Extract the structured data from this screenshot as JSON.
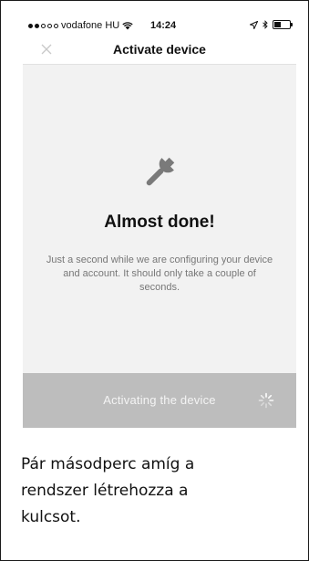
{
  "status_bar": {
    "carrier": "vodafone HU",
    "time": "14:24",
    "signal_bars_filled": 2,
    "signal_bars_total": 5,
    "battery_level": 0.45,
    "icons": [
      "signal-dots-icon",
      "wifi-icon",
      "location-arrow-icon",
      "bluetooth-icon",
      "battery-icon"
    ]
  },
  "nav": {
    "title": "Activate device",
    "close_icon": "close-icon"
  },
  "main": {
    "icon": "wrench-icon",
    "headline": "Almost done!",
    "description": "Just a second while we are configuring your device and account. It should only take a couple of seconds."
  },
  "bottom": {
    "label": "Activating the device",
    "spinner_icon": "loading-spinner-icon"
  },
  "caption": {
    "line1": "Pár másodperc amíg a",
    "line2": "rendszer létrehozza a",
    "line3": "kulcsot."
  },
  "colors": {
    "screen_background": "#f2f2f2",
    "bottom_bar": "#bdbdbd",
    "description_text": "#777777"
  }
}
